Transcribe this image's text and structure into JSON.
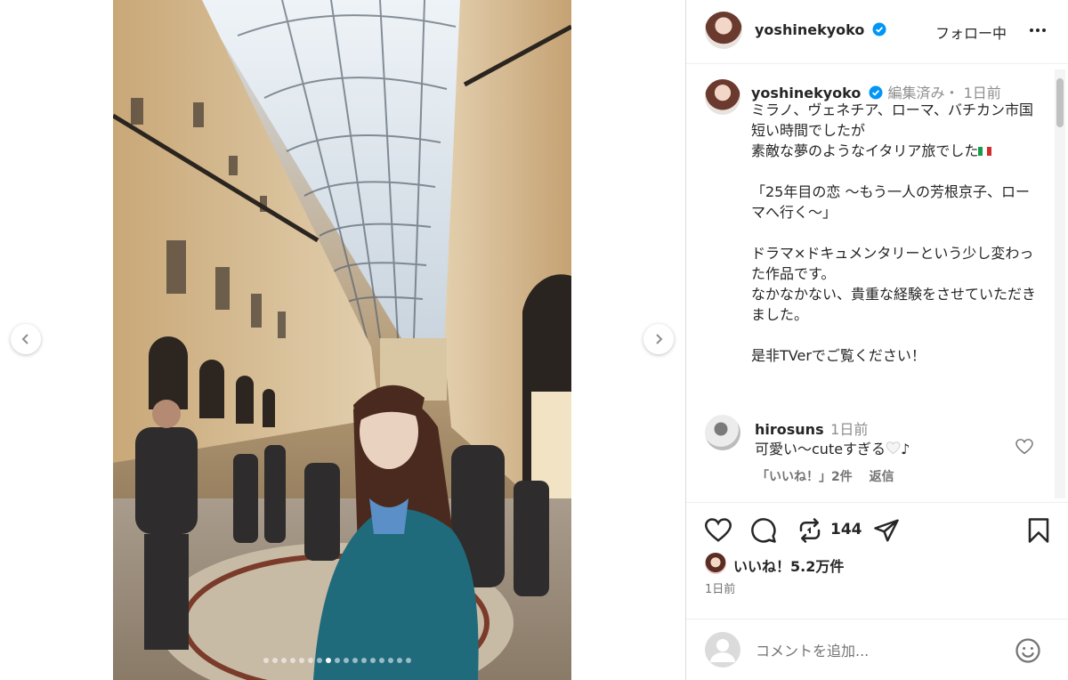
{
  "header": {
    "username": "yoshinekyoko",
    "follow_status": "フォロー中"
  },
  "caption": {
    "username": "yoshinekyoko",
    "meta": "編集済み・ 1日前",
    "text": "ミラノ、ヴェネチア、ローマ、バチカン市国\n短い時間でしたが\n素敵な夢のようなイタリア旅でした",
    "text2": "「25年目の恋 〜もう一人の芳根京子、ローマへ行く〜」\n\nドラマ×ドキュメンタリーという少し変わった作品です。\nなかなかない、貴重な経験をさせていただきました。\n\n是非TVerでご覧ください！"
  },
  "comment": {
    "username": "hirosuns",
    "time": "1日前",
    "text": "可愛い〜cuteすぎる",
    "suffix": "♪",
    "likes": "「いいね！」2件",
    "reply": "返信"
  },
  "actions": {
    "repost_count": "144",
    "likes_text": "いいね！5.2万件",
    "posted": "1日前"
  },
  "add_comment": {
    "placeholder": "コメントを追加..."
  },
  "carousel": {
    "total": 17,
    "active_index": 7
  },
  "colors": {
    "verified": "#0095f6",
    "text": "#262626",
    "muted": "#737373"
  }
}
